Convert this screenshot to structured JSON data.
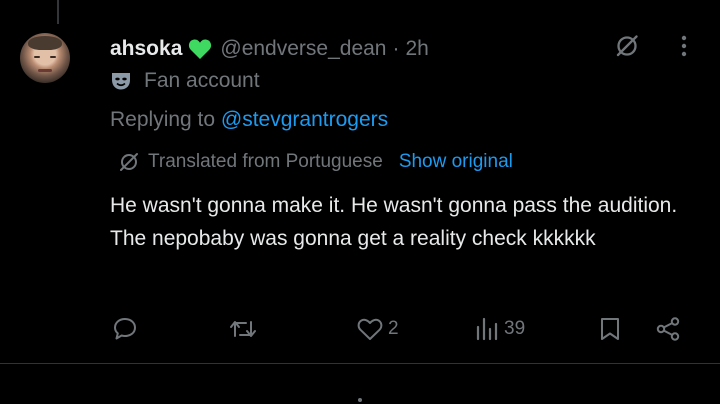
{
  "tweet": {
    "author_name": "ahsoka",
    "handle": "@endverse_dean",
    "separator": "·",
    "time": "2h",
    "label": "Fan account",
    "reply_prefix": "Replying to",
    "reply_to": "@stevgrantrogers",
    "translated_from": "Translated from Portuguese",
    "show_original": "Show original",
    "text": "He wasn't gonna make it. He wasn't gonna pass the audition. The nepobaby was gonna get a reality check kkkkkk"
  },
  "icons": {
    "heart_emoji": "green-heart-icon",
    "label": "theater-mask-icon",
    "translate": "translate-icon",
    "grok": "grok-icon",
    "more": "more-dots-icon",
    "reply": "reply-icon",
    "retweet": "retweet-icon",
    "like": "heart-icon",
    "views": "views-chart-icon",
    "bookmark": "bookmark-icon",
    "share": "share-icon"
  },
  "actions": {
    "reply_count": "",
    "retweet_count": "",
    "like_count": "2",
    "views_count": "39"
  },
  "colors": {
    "background": "#000000",
    "primary_text": "#e7e9ea",
    "secondary_text": "#71767b",
    "link": "#1d9bf0",
    "emoji_green": "#3fd860",
    "divider": "#2f3336"
  }
}
